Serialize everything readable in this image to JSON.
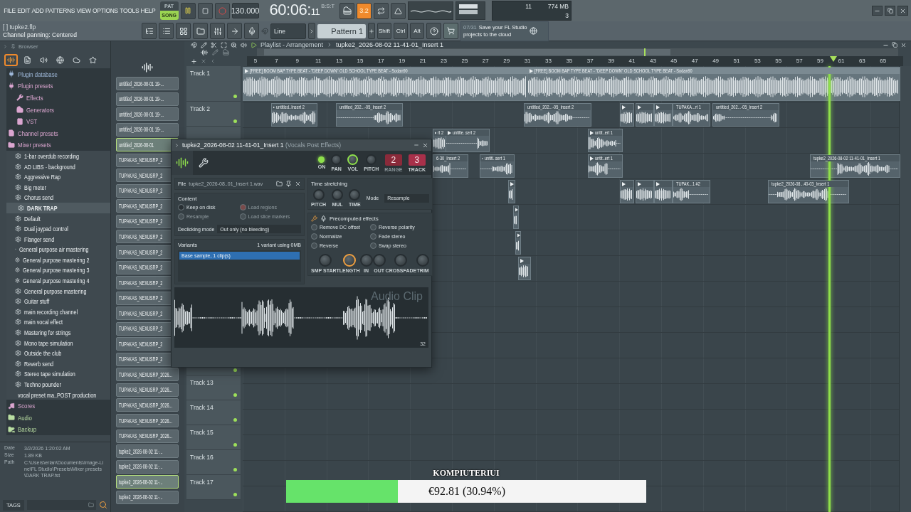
{
  "menu": [
    "FILE",
    "EDIT",
    "ADD",
    "PATTERNS",
    "VIEW",
    "OPTIONS",
    "TOOLS",
    "HELP"
  ],
  "transport": {
    "modes": [
      {
        "label": "PAT",
        "selected": false
      },
      {
        "label": "SONG",
        "selected": true
      }
    ],
    "playing": true,
    "tempo": "130.000",
    "time": "60:06:",
    "time_ticks": "11",
    "time_label": "B:S:T",
    "countdown": "3.2"
  },
  "performance": {
    "cpu": "11",
    "memory": "774 MB",
    "polyphony": "3"
  },
  "hint_bar": {
    "file": "[ ] tupke2.flp",
    "message": "Channel panning: Centered"
  },
  "snap": {
    "value": "Line"
  },
  "pattern": {
    "value": "Pattern 1"
  },
  "modifiers": [
    "Shift",
    "Ctrl",
    "Alt"
  ],
  "news": {
    "count": "07/31",
    "message": "Save your FL Studio projects to the cloud"
  },
  "browser": {
    "title": "Browser",
    "tabs": [
      {
        "selected": true
      },
      {
        "selected": false
      },
      {
        "selected": false
      },
      {
        "selected": false
      },
      {
        "selected": false
      },
      {
        "selected": false
      }
    ],
    "items": [
      {
        "label": "Plugin database",
        "kind": "folder",
        "color": "#9fb9da",
        "selected": false
      },
      {
        "label": "Plugin presets",
        "kind": "folder",
        "color": "#dba6d0",
        "selected": false,
        "children": [
          {
            "label": "Effects",
            "kind": "folder",
            "color": "#dba6d0",
            "selected": false
          },
          {
            "label": "Generators",
            "kind": "folder",
            "color": "#dba6d0",
            "selected": false
          },
          {
            "label": "VST",
            "kind": "folder",
            "color": "#dba6d0",
            "selected": false
          }
        ]
      },
      {
        "label": "Channel presets",
        "kind": "folder",
        "color": "#dba6d0",
        "selected": false
      },
      {
        "label": "Mixer presets",
        "kind": "folder",
        "color": "#dba6d0",
        "selected": false,
        "children": [
          {
            "label": "1-bar overdub recording",
            "kind": "preset",
            "selected": false
          },
          {
            "label": "AD LIBS - background",
            "kind": "preset",
            "selected": false
          },
          {
            "label": "Aggressive Rap",
            "kind": "preset",
            "selected": false
          },
          {
            "label": "Big meter",
            "kind": "preset",
            "selected": false
          },
          {
            "label": "Chorus send",
            "kind": "preset",
            "selected": false
          },
          {
            "label": "DARK TRAP",
            "kind": "preset",
            "selected": true
          },
          {
            "label": "Default",
            "kind": "preset",
            "selected": false
          },
          {
            "label": "Dual joypad control",
            "kind": "preset",
            "selected": false
          },
          {
            "label": "Flanger send",
            "kind": "preset",
            "selected": false
          },
          {
            "label": "General purpose air mastering",
            "kind": "preset",
            "selected": false
          },
          {
            "label": "General purpose mastering 2",
            "kind": "preset",
            "selected": false
          },
          {
            "label": "General purpose mastering 3",
            "kind": "preset",
            "selected": false
          },
          {
            "label": "General purpose mastering 4",
            "kind": "preset",
            "selected": false
          },
          {
            "label": "General purpose mastering",
            "kind": "preset",
            "selected": false
          },
          {
            "label": "Guitar stuff",
            "kind": "preset",
            "selected": false
          },
          {
            "label": "main recording channel",
            "kind": "preset",
            "selected": false
          },
          {
            "label": "main vocal effect",
            "kind": "preset",
            "selected": false
          },
          {
            "label": "Mastering for strings",
            "kind": "preset",
            "selected": false
          },
          {
            "label": "Mono tape simulation",
            "kind": "preset",
            "selected": false
          },
          {
            "label": "Outside the club",
            "kind": "preset",
            "selected": false
          },
          {
            "label": "Reverb send",
            "kind": "preset",
            "selected": false
          },
          {
            "label": "Stereo tape simulation",
            "kind": "preset",
            "selected": false
          },
          {
            "label": "Techno pounder",
            "kind": "preset",
            "selected": false
          },
          {
            "label": "vocal preset ma..POST production",
            "kind": "preset",
            "selected": false
          }
        ]
      },
      {
        "label": "Scores",
        "kind": "folder",
        "color": "#dba6d0",
        "selected": false
      },
      {
        "label": "Audio",
        "kind": "folder",
        "color": "#b9dea2",
        "selected": false
      },
      {
        "label": "Backup",
        "kind": "folder",
        "color": "#b9dea2",
        "selected": false
      }
    ],
    "info": [
      {
        "label": "Date",
        "value": "3/2/2026 1:20:02 AM"
      },
      {
        "label": "Size",
        "value": "1.89 KB"
      },
      {
        "label": "Path",
        "value": "C:\\Users\\erlan\\Documents\\Image-Line\\FL Studio\\Presets\\Mixer presets\\DARK TRAP.fst"
      }
    ],
    "tags_label": "TAGS"
  },
  "channels": [
    {
      "label": "untitled_2026-08-01 19-...",
      "selected": false
    },
    {
      "label": "untitled_2026-08-01 19-...",
      "selected": false
    },
    {
      "label": "untitled_2026-08-01 19-...",
      "selected": false
    },
    {
      "label": "untitled_2026-08-01 19-...",
      "selected": false
    },
    {
      "label": "untitled_2026-08-01",
      "selected": true
    },
    {
      "label": "TUPAKAS_NEXUSRP_2",
      "selected": false
    },
    {
      "label": "TUPAKAS_NEXUSRP_2",
      "selected": false
    },
    {
      "label": "TUPAKAS_NEXUSRP_2",
      "selected": false
    },
    {
      "label": "TUPAKAS_NEXUSRP_2",
      "selected": false
    },
    {
      "label": "TUPAKAS_NEXUSRP_2",
      "selected": false
    },
    {
      "label": "TUPAKAS_NEXUSRP_2",
      "selected": false
    },
    {
      "label": "TUPAKAS_NEXUSRP_2",
      "selected": false
    },
    {
      "label": "TUPAKAS_NEXUSRP_2",
      "selected": false
    },
    {
      "label": "TUPAKAS_NEXUSRP_2",
      "selected": false
    },
    {
      "label": "TUPAKAS_NEXUSRP_2",
      "selected": false
    },
    {
      "label": "TUPAKAS_NEXUSRP_2",
      "selected": false
    },
    {
      "label": "TUPAKAS_NEXUSRP_2",
      "selected": false
    },
    {
      "label": "TUPAKAS_NEXUSRP_2",
      "selected": false
    },
    {
      "label": "TUPAKAS_NEXUSRP_2",
      "selected": false
    },
    {
      "label": "TUPAKAS_NEXUSRP_2026...",
      "selected": false
    },
    {
      "label": "TUPAKAS_NEXUSRP_2026...",
      "selected": false
    },
    {
      "label": "TUPAKAS_NEXUSRP_2026...",
      "selected": false
    },
    {
      "label": "TUPAKAS_NEXUSRP_2026...",
      "selected": false
    },
    {
      "label": "TUPAKAS_NEXUSRP_2026...",
      "selected": false
    },
    {
      "label": "tupke2_2026-08-02 11-...",
      "selected": false
    },
    {
      "label": "tupke2_2026-08-02 11-...",
      "selected": false
    },
    {
      "label": "tupke2_2026-08-02 11-...",
      "selected": true
    },
    {
      "label": "tupke2_2026-08-02 11-...",
      "selected": false
    }
  ],
  "playlist": {
    "title": "Playlist - Arrangement",
    "breadcrumb": "tupke2_2026-08-02 11-41-01_Insert 1",
    "bars": [
      "5",
      "7",
      "9",
      "11",
      "13",
      "15",
      "17",
      "19",
      "21",
      "23",
      "25",
      "27",
      "29",
      "31",
      "33",
      "35",
      "37",
      "39",
      "41",
      "43",
      "45",
      "47",
      "49",
      "51",
      "53",
      "55",
      "57",
      "59",
      "61",
      "63",
      "65"
    ],
    "tracks": [
      {
        "label": "Track 1",
        "enabled": true,
        "clips": [
          {
            "kind": "audio",
            "name": "[FREE] BOOM BAP TYPE BEAT - \"DEEP DOWN\" OLD SCHOOL TYPE BEAT - Sodan90"
          },
          {
            "kind": "audio",
            "name": "[FREE] BOOM BAP TYPE BEAT - \"DEEP DOWN\" OLD SCHOOL TYPE BEAT - Sodan90"
          }
        ]
      },
      {
        "label": "Track 2",
        "enabled": true,
        "clips": [
          {
            "kind": "audio",
            "name": "untitled..Insert 2"
          },
          {
            "kind": "audio",
            "name": "untitled_202...-05_Insert 2"
          },
          {
            "kind": "audio",
            "name": "untitled_202...-05_Insert 2"
          },
          {
            "kind": "audio"
          },
          {
            "kind": "audio"
          },
          {
            "kind": "audio"
          },
          {
            "kind": "audio",
            "name": "TUPAKA...rt 1"
          },
          {
            "kind": "audio",
            "name": "untitled_202...-05_Insert 2"
          }
        ]
      },
      {
        "clips": [
          {
            "kind": "audio",
            "name": "rt 2"
          },
          {
            "kind": "audio",
            "name": "untitle..sert 2"
          },
          {
            "kind": "audio",
            "name": "untit..ert 1"
          }
        ]
      },
      {
        "clips": [
          {
            "kind": "audio",
            "name": "6-30_Insert 2"
          },
          {
            "kind": "audio",
            "name": "untitl..sert 1"
          },
          {
            "kind": "audio",
            "name": "untit..ert 1"
          },
          {
            "kind": "audio",
            "name": "tupke2_2026-08-02 11-41-01_Insert 1"
          }
        ]
      },
      {
        "clips": [
          {
            "kind": "audio"
          },
          {
            "kind": "audio"
          },
          {
            "kind": "audio"
          },
          {
            "kind": "audio"
          },
          {
            "kind": "audio",
            "name": "TUPAK...1 #2"
          },
          {
            "kind": "audio",
            "name": "tupke2_2026-08...40-03_Insert 1"
          }
        ]
      },
      {
        "clips": [
          {
            "kind": "audio"
          }
        ]
      },
      {
        "clips": [
          {
            "kind": "audio"
          }
        ]
      },
      {
        "clips": [
          {
            "kind": "audio"
          }
        ]
      }
    ],
    "lower_tracks": [
      {
        "enabled": true
      },
      {
        "label": "Track 13",
        "enabled": true
      },
      {
        "label": "Track 14",
        "enabled": true
      },
      {
        "label": "Track 15",
        "enabled": true
      },
      {
        "label": "Track 16",
        "enabled": true
      },
      {
        "label": "Track 17",
        "enabled": true
      }
    ]
  },
  "sample_dialog": {
    "title": "tupke2_2026-08-02 11-41-01_Insert 1",
    "subtitle": "(Vocals Post  Effects)",
    "top_controls": [
      {
        "kind": "led",
        "label": "ON",
        "on": true
      },
      {
        "kind": "knob",
        "label": "PAN",
        "highlighted": false
      },
      {
        "kind": "knob",
        "label": "VOL",
        "highlighted": true
      },
      {
        "kind": "knob",
        "label": "PITCH",
        "highlighted": false
      },
      {
        "kind": "counter",
        "value": "2",
        "label": "RANGE",
        "disabled": true
      },
      {
        "kind": "counter",
        "value": "3",
        "label": "TRACK",
        "disabled": false
      }
    ],
    "file_label": "File",
    "file_name": "tupke2_2026-08..01_Insert 1.wav",
    "content": {
      "title": "Content",
      "options": [
        {
          "label": "Keep on disk",
          "checked": true,
          "disabled": false
        },
        {
          "label": "Load regions",
          "checked": true,
          "disabled": true
        },
        {
          "label": "Resample",
          "checked": false,
          "disabled": true
        },
        {
          "label": "Load slice markers",
          "checked": false,
          "disabled": true
        }
      ],
      "declicking_label": "Declicking mode",
      "declicking_value": "Out only (no bleeding)"
    },
    "variants": {
      "title": "Variants",
      "summary": "1 variant using 0MB",
      "items": [
        {
          "label": "Base sample, 1 clip(s)",
          "selected": true
        }
      ]
    },
    "time_stretching": {
      "title": "Time stretching",
      "knobs": [
        {
          "label": "PITCH",
          "highlighted": false
        },
        {
          "label": "MUL",
          "highlighted": false
        },
        {
          "label": "TIME",
          "highlighted": false
        }
      ],
      "mode_label": "Mode",
      "mode_value": "Resample"
    },
    "precomputed": {
      "title": "Precomputed effects",
      "options": [
        {
          "label": "Remove DC offset",
          "checked": false
        },
        {
          "label": "Reverse polarity",
          "checked": false
        },
        {
          "label": "Normalize",
          "checked": false
        },
        {
          "label": "Fade stereo",
          "checked": false
        },
        {
          "label": "Reverse",
          "checked": false
        },
        {
          "label": "Swap stereo",
          "checked": false
        }
      ],
      "knobs": [
        {
          "label": "SMP START",
          "highlighted": false
        },
        {
          "label": "LENGTH",
          "highlighted": true
        },
        {
          "label": "IN",
          "highlighted": false
        },
        {
          "label": "OUT",
          "highlighted": false
        },
        {
          "label": "CROSSFADE",
          "highlighted": false
        },
        {
          "label": "TRIM",
          "highlighted": false
        }
      ]
    },
    "waveform": {
      "watermark": "Audio Clip",
      "zoom": "32"
    }
  },
  "donation": {
    "title": "KOMPIUTERIUI",
    "level": 0.3094,
    "amount": "€92.81 (30.94%)"
  }
}
